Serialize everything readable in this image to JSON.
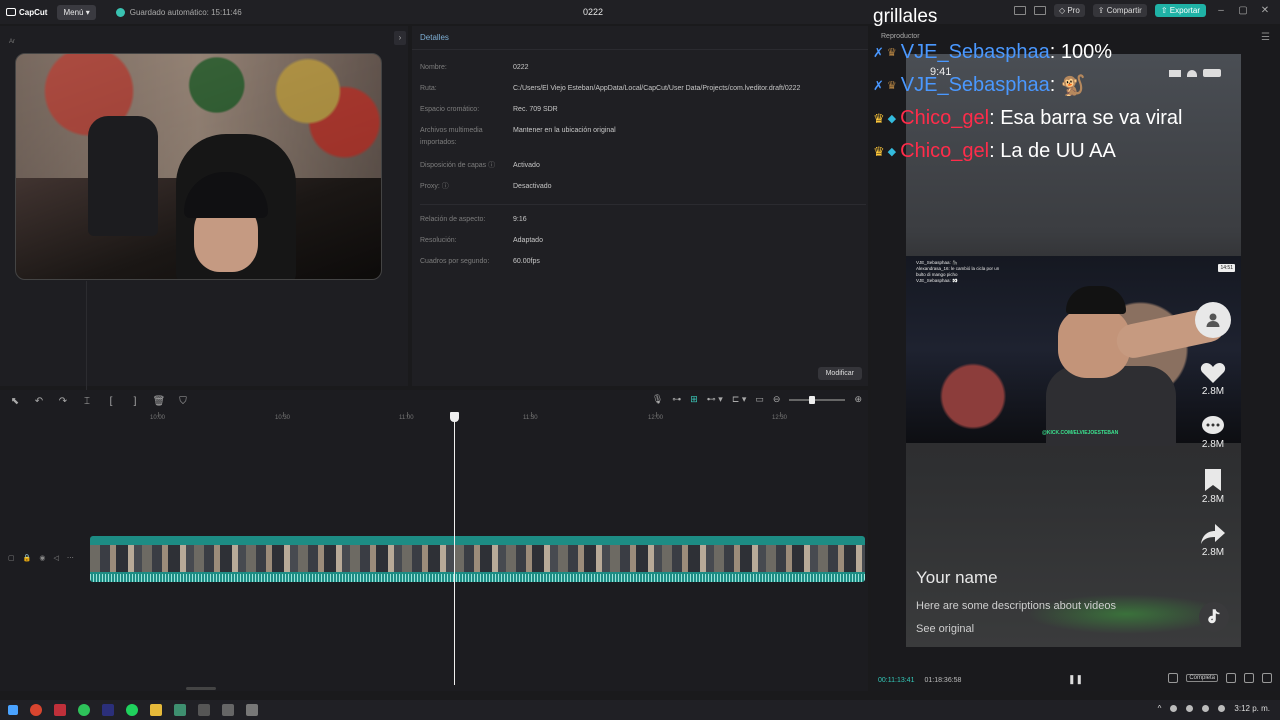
{
  "app": {
    "logo_text": "CapCut",
    "menu_label": "Menú",
    "autosave_text": "Guardado automático: 15:11:46",
    "project_title": "0222",
    "pro_label": "Pro",
    "share_label": "Compartir",
    "export_label": "Exportar"
  },
  "media": {
    "tab_label": "Ar"
  },
  "details": {
    "header": "Detalles",
    "rows": [
      {
        "label": "Nombre:",
        "value": "0222"
      },
      {
        "label": "Ruta:",
        "value": "C:/Users/El Viejo Esteban/AppData/Local/CapCut/User Data/Projects/com.lveditor.draft/0222"
      },
      {
        "label": "Espacio cromático:",
        "value": "Rec. 709 SDR"
      },
      {
        "label": "Archivos multimedia importados:",
        "value": "Mantener en la ubicación original"
      },
      {
        "label": "Disposición de capas",
        "value": "Activado"
      },
      {
        "label": "Proxy:",
        "value": "Desactivado"
      },
      {
        "label": "Relación de aspecto:",
        "value": "9:16"
      },
      {
        "label": "Resolución:",
        "value": "Adaptado"
      },
      {
        "label": "Cuadros por segundo:",
        "value": "60.00fps"
      }
    ],
    "modify_label": "Modificar"
  },
  "player": {
    "label": "Reproductor",
    "status_time": "9:41",
    "name": "Your name",
    "description": "Here are some descriptions about videos",
    "see_original": "See original",
    "counts": [
      "2.8M",
      "2.8M",
      "2.8M",
      "2.8M"
    ],
    "current_time": "00:11:13:41",
    "total_time": "01:18:36:58",
    "full_label": "Completa",
    "video_chat": [
      "VJE_Sebasphaa: 🦍",
      "Alexandrasa_16: le cambió la cicla por un",
      "bulto di mango picho",
      "VJE_Sebasphaa: 👀"
    ],
    "video_badge": "14:51",
    "watermark": "@KICK.COM/ELVIEJOESTEBAN"
  },
  "overlay": {
    "streamer": "grillales",
    "chat": [
      {
        "user": "VJE_Sebasphaa",
        "message": "100%",
        "color": "#4a98ff"
      },
      {
        "user": "VJE_Sebasphaa",
        "message": "🐒",
        "color": "#4a98ff"
      },
      {
        "user": "Chico_gel",
        "message": "Esa barra se va viral",
        "color": "#ff2c4a"
      },
      {
        "user": "Chico_gel",
        "message": "La de UU AA",
        "color": "#ff2c4a"
      }
    ]
  },
  "timeline": {
    "ruler": [
      "10:00",
      "10:30",
      "11:00",
      "11:30",
      "12:00",
      "12:30"
    ]
  },
  "taskbar": {
    "time": "3:12 p. m."
  },
  "colors": {
    "accent": "#1fb2a6",
    "timecode": "#33c8b8"
  }
}
